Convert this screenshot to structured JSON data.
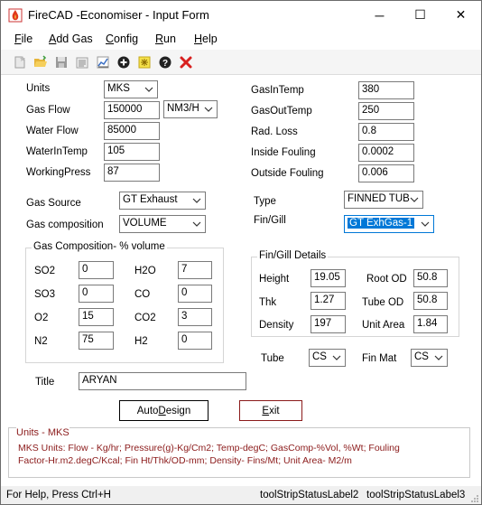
{
  "window": {
    "title": "FireCAD -Economiser - Input Form",
    "minimize": "─",
    "maximize": "☐",
    "close": "✕"
  },
  "menu": [
    {
      "label": "File",
      "key": "F",
      "rest": "ile"
    },
    {
      "label": "Add Gas",
      "key": "A",
      "rest": "dd Gas"
    },
    {
      "label": "Config",
      "key": "C",
      "rest": "onfig"
    },
    {
      "label": "Run",
      "key": "R",
      "rest": "un"
    },
    {
      "label": "Help",
      "key": "H",
      "rest": "elp"
    }
  ],
  "toolbar": {
    "icons": [
      "new-icon",
      "open-icon",
      "save-icon",
      "report-icon",
      "chart-icon",
      "add-icon",
      "design-icon",
      "help-icon",
      "delete-icon"
    ]
  },
  "left_fields": {
    "units_label": "Units",
    "units_value": "MKS",
    "gas_flow_label": "Gas Flow",
    "gas_flow_value": "150000",
    "gas_flow_unit": "NM3/H",
    "water_flow_label": "Water Flow",
    "water_flow_value": "85000",
    "water_in_temp_label": "WaterInTemp",
    "water_in_temp_value": "105",
    "working_press_label": "WorkingPress",
    "working_press_value": "87"
  },
  "right_fields": {
    "gas_in_temp_label": "GasInTemp",
    "gas_in_temp_value": "380",
    "gas_out_temp_label": "GasOutTemp",
    "gas_out_temp_value": "250",
    "rad_loss_label": "Rad. Loss",
    "rad_loss_value": "0.8",
    "inside_fouling_label": "Inside Fouling",
    "inside_fouling_value": "0.0002",
    "outside_fouling_label": "Outside Fouling",
    "outside_fouling_value": "0.006"
  },
  "gas": {
    "source_label": "Gas Source",
    "source_value": "GT Exhaust",
    "composition_label": "Gas composition",
    "composition_value": "VOLUME"
  },
  "type": {
    "type_label": "Type",
    "type_value": "FINNED TUB",
    "fin_gill_label": "Fin/Gill",
    "fin_gill_value": "GT ExhGas-1"
  },
  "composition": {
    "title": "Gas Composition- % volume",
    "so2_label": "SO2",
    "so2_value": "0",
    "h2o_label": "H2O",
    "h2o_value": "7",
    "so3_label": "SO3",
    "so3_value": "0",
    "co_label": "CO",
    "co_value": "0",
    "o2_label": "O2",
    "o2_value": "15",
    "co2_label": "CO2",
    "co2_value": "3",
    "n2_label": "N2",
    "n2_value": "75",
    "h2_label": "H2",
    "h2_value": "0"
  },
  "fin_details": {
    "title": "Fin/Gill Details",
    "height_label": "Height",
    "height_value": "19.05",
    "root_od_label": "Root OD",
    "root_od_value": "50.8",
    "thk_label": "Thk",
    "thk_value": "1.27",
    "tube_od_label": "Tube OD",
    "tube_od_value": "50.8",
    "density_label": "Density",
    "density_value": "197",
    "unit_area_label": "Unit Area",
    "unit_area_value": "1.84"
  },
  "tube": {
    "tube_label": "Tube",
    "tube_value": "CS",
    "fin_mat_label": "Fin Mat",
    "fin_mat_value": "CS"
  },
  "title_field": {
    "label": "Title",
    "value": "ARYAN"
  },
  "buttons": {
    "autodesign_pre": "Auto",
    "autodesign_key": "D",
    "autodesign_post": "esign",
    "exit_key": "E",
    "exit_post": "xit"
  },
  "units_info": {
    "title": "Units - MKS",
    "line1": "MKS Units: Flow - Kg/hr; Pressure(g)-Kg/Cm2; Temp-degC; GasComp-%Vol, %Wt; Fouling",
    "line2": "Factor-Hr.m2.degC/Kcal; Fin Ht/Thk/OD-mm; Density- Fins/Mt; Unit Area- M2/m"
  },
  "status": {
    "help": "For Help, Press Ctrl+H",
    "label2": "toolStripStatusLabel2",
    "label3": "toolStripStatusLabel3"
  }
}
